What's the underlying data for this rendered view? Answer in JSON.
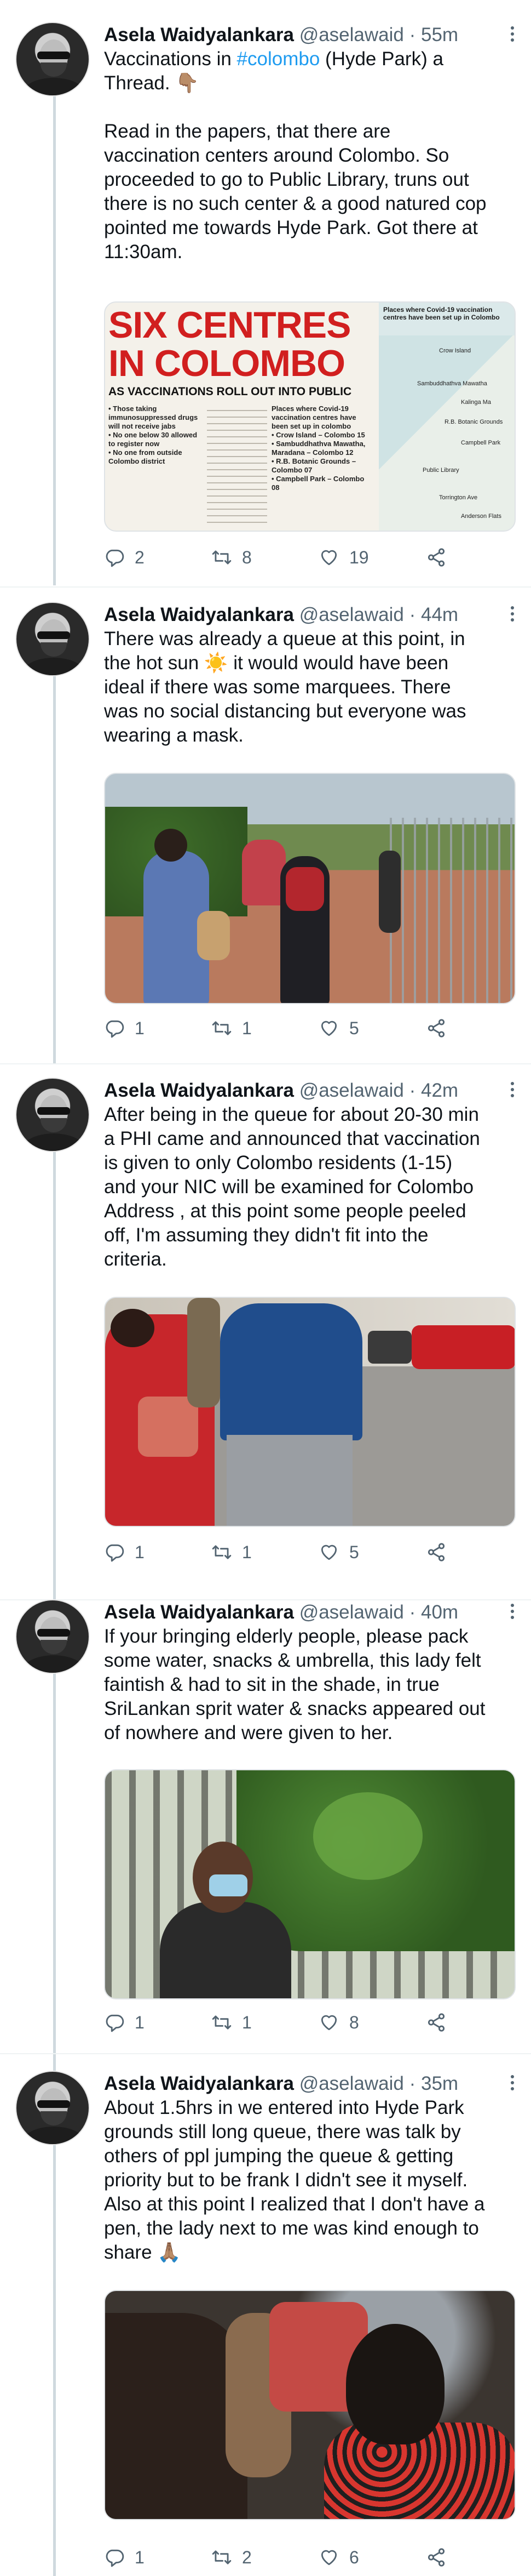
{
  "colors": {
    "link": "#1d9bf0",
    "secondary": "#536471",
    "text": "#0f1419",
    "newspaper_red": "#d11f1f"
  },
  "tweets": [
    {
      "name": "Asela Waidyalankara",
      "handle": "@aselawaid",
      "dot": "·",
      "time": "55m",
      "text_before": "Vaccinations in ",
      "hashtag": "#colombo",
      "text_after": " (Hyde Park) a\nThread. 👇🏽\n\nRead in the papers, that there are\nvaccination centers around Colombo. So\nproceeded to go to Public Library, truns out\nthere is no such center & a good natured cop\npointed me towards Hyde Park. Got there at\n11:30am.",
      "replies": "2",
      "retweets": "8",
      "likes": "19",
      "newspaper": {
        "headline1": "SIX CENTRES",
        "headline2": "IN COLOMBO",
        "subhead": "AS VACCINATIONS ROLL OUT INTO PUBLIC",
        "col1": "• Those taking immunosuppressed drugs will not receive jabs\n• No one below 30 allowed to register now\n• No one from outside Colombo district",
        "col3": "Places where Covid-19 vaccination centres have been set up in colombo\n• Crow Island – Colombo 15\n• Sambuddhathva Mawatha, Maradana – Colombo 12\n• R.B. Botanic Grounds – Colombo 07\n• Campbell Park – Colombo 08",
        "map_title": "Places where Covid-19 vaccination centres have been set up in Colombo",
        "map_labels": [
          "Crow Island",
          "Sambuddhathva Mawatha",
          "Kalinga Ma",
          "R.B. Botanic Grounds",
          "Campbell Park",
          "Public Library",
          "Torrington Ave",
          "Anderson Flats"
        ]
      }
    },
    {
      "name": "Asela Waidyalankara",
      "handle": "@aselawaid",
      "dot": "·",
      "time": "44m",
      "text": "There was already a queue at this point, in\nthe hot sun ☀️ it would would have been\nideal if there was some marquees. There\nwas no social distancing but everyone was\nwearing a mask.",
      "replies": "1",
      "retweets": "1",
      "likes": "5"
    },
    {
      "name": "Asela Waidyalankara",
      "handle": "@aselawaid",
      "dot": "·",
      "time": "42m",
      "text": "After being in the queue for about 20-30 min\na PHI came and announced that vaccination\nis given to only Colombo residents (1-15)\nand your NIC will be examined for Colombo\nAddress , at this point some people peeled\noff, I'm assuming they didn't fit into the\ncriteria.",
      "replies": "1",
      "retweets": "1",
      "likes": "5"
    },
    {
      "name": "Asela Waidyalankara",
      "handle": "@aselawaid",
      "dot": "·",
      "time": "40m",
      "text": "If your bringing elderly people, please pack\nsome water, snacks & umbrella, this lady felt\nfaintish & had to sit in the shade, in true\nSriLankan sprit water & snacks appeared out\nof nowhere and were given to her.",
      "replies": "1",
      "retweets": "1",
      "likes": "8"
    },
    {
      "name": "Asela Waidyalankara",
      "handle": "@aselawaid",
      "dot": "·",
      "time": "35m",
      "text": "About 1.5hrs in we entered into Hyde Park\ngrounds still long queue, there was talk by\nothers of ppl jumping the queue & getting\npriority but to be frank I didn't see it myself.\nAlso at this point I realized that I don't have a\npen, the lady next to me was kind enough to\nshare 🙏🏽",
      "replies": "1",
      "retweets": "2",
      "likes": "6"
    }
  ]
}
